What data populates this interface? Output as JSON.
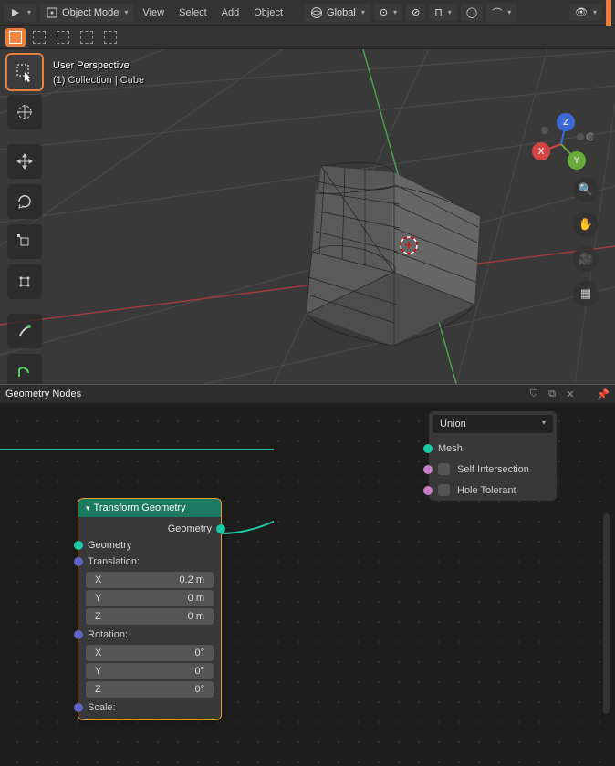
{
  "header": {
    "mode": "Object Mode",
    "menu": [
      "View",
      "Select",
      "Add",
      "Object"
    ],
    "orientation": "Global"
  },
  "viewport": {
    "overlay_line1": "User Perspective",
    "overlay_line2": "(1) Collection | Cube"
  },
  "panel": {
    "title": "Geometry Nodes"
  },
  "union_node": {
    "mode": "Union",
    "rows": [
      "Mesh",
      "Self Intersection",
      "Hole Tolerant"
    ]
  },
  "transform_node": {
    "title": "Transform Geometry",
    "geom_out": "Geometry",
    "geom_in": "Geometry",
    "translation": {
      "label": "Translation:",
      "x_label": "X",
      "x_val": "0.2 m",
      "y_label": "Y",
      "y_val": "0 m",
      "z_label": "Z",
      "z_val": "0 m"
    },
    "rotation": {
      "label": "Rotation:",
      "x_label": "X",
      "x_val": "0°",
      "y_label": "Y",
      "y_val": "0°",
      "z_label": "Z",
      "z_val": "0°"
    },
    "scale": {
      "label": "Scale:"
    }
  }
}
